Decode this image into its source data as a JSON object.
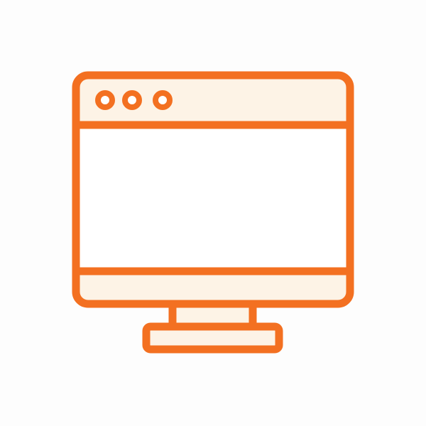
{
  "icon": {
    "name": "desktop-monitor-icon",
    "colors": {
      "stroke": "#f37021",
      "fill_light": "#fdf3e6",
      "fill_white": "#ffffff",
      "background": "#fdfdfd"
    },
    "window_controls": [
      "dot-icon",
      "dot-icon",
      "dot-icon"
    ]
  }
}
